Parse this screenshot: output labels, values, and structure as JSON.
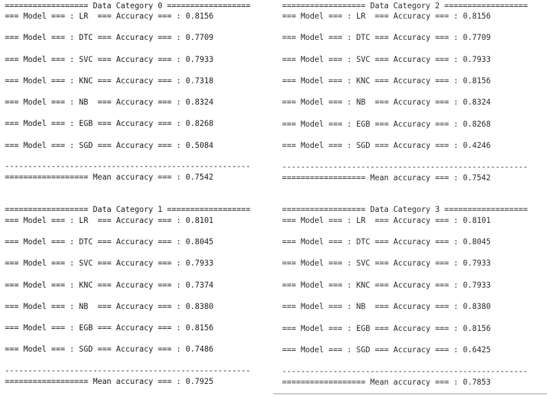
{
  "separator": "-----------------------------------------------------",
  "mean_prefix": "================== Mean accuracy === :",
  "row_prefix": "=== Model === :",
  "row_mid": "=== Accuracy === :",
  "panels": [
    {
      "header": "================== Data Category 0 ==================",
      "rows": [
        {
          "model": "LR ",
          "acc": "0.8156"
        },
        {
          "model": "DTC",
          "acc": "0.7709"
        },
        {
          "model": "SVC",
          "acc": "0.7933"
        },
        {
          "model": "KNC",
          "acc": "0.7318"
        },
        {
          "model": "NB ",
          "acc": "0.8324"
        },
        {
          "model": "EGB",
          "acc": "0.8268"
        },
        {
          "model": "SGD",
          "acc": "0.5084"
        }
      ],
      "mean": "0.7542"
    },
    {
      "header": "================== Data Category 1 ==================",
      "rows": [
        {
          "model": "LR ",
          "acc": "0.8101"
        },
        {
          "model": "DTC",
          "acc": "0.8045"
        },
        {
          "model": "SVC",
          "acc": "0.7933"
        },
        {
          "model": "KNC",
          "acc": "0.7374"
        },
        {
          "model": "NB ",
          "acc": "0.8380"
        },
        {
          "model": "EGB",
          "acc": "0.8156"
        },
        {
          "model": "SGD",
          "acc": "0.7486"
        }
      ],
      "mean": "0.7925"
    },
    {
      "header": "================== Data Category 2 ==================",
      "rows": [
        {
          "model": "LR ",
          "acc": "0.8156"
        },
        {
          "model": "DTC",
          "acc": "0.7709"
        },
        {
          "model": "SVC",
          "acc": "0.7933"
        },
        {
          "model": "KNC",
          "acc": "0.8156"
        },
        {
          "model": "NB ",
          "acc": "0.8324"
        },
        {
          "model": "EGB",
          "acc": "0.8268"
        },
        {
          "model": "SGD",
          "acc": "0.4246"
        }
      ],
      "mean": "0.7542"
    },
    {
      "header": "================== Data Category 3 ==================",
      "rows": [
        {
          "model": "LR ",
          "acc": "0.8101"
        },
        {
          "model": "DTC",
          "acc": "0.8045"
        },
        {
          "model": "SVC",
          "acc": "0.7933"
        },
        {
          "model": "KNC",
          "acc": "0.7933"
        },
        {
          "model": "NB ",
          "acc": "0.8380"
        },
        {
          "model": "EGB",
          "acc": "0.8156"
        },
        {
          "model": "SGD",
          "acc": "0.6425"
        }
      ],
      "mean": "0.7853"
    }
  ]
}
